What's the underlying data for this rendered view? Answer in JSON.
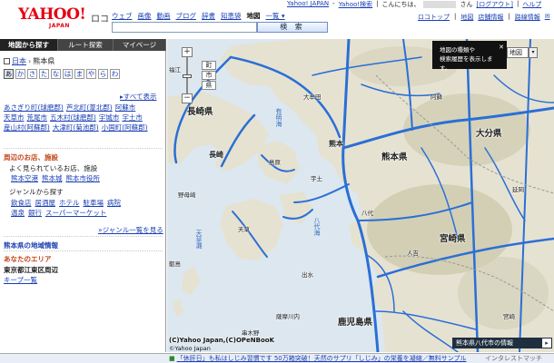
{
  "header": {
    "logo_text": "YAHOO!",
    "logo_sub": "JAPAN",
    "service_name": "ロコ",
    "service_links": [
      "ウェブ",
      "画像",
      "動画",
      "ブログ",
      "辞書",
      "知恵袋",
      "地図",
      "一覧 ▾"
    ],
    "current_service": "地図",
    "search_button": "検 索",
    "search_placeholder": "",
    "top_links": {
      "yahoo_japan": "Yahoo! JAPAN",
      "dash1": "-",
      "yahoo_search": "Yahoo!検索",
      "pipe1": "|",
      "greeting": "こんにちは、",
      "san": "さん",
      "logout": "[ログアウト]",
      "pipe2": "|",
      "help": "ヘルプ"
    },
    "tools": [
      "ロコトップ",
      "|",
      "地図",
      "店舗情報",
      "|",
      "路線情報",
      "✉",
      "⚙"
    ]
  },
  "sidebar": {
    "tabs": [
      {
        "label": "地図から探す",
        "active": true
      },
      {
        "label": "ルート探索",
        "active": false
      },
      {
        "label": "マイページ",
        "active": false
      }
    ],
    "breadcrumb": {
      "root": "日本",
      "sep": "›",
      "current": "熊本県"
    },
    "kana": [
      "あ",
      "か",
      "さ",
      "た",
      "な",
      "は",
      "ま",
      "や",
      "ら",
      "わ"
    ],
    "kana_selected": "あ",
    "show_all": "▸すべて表示",
    "cities": [
      "あさぎり町(球磨郡)",
      "芦北町(葦北郡)",
      "阿蘇市",
      "天草市",
      "荒尾市",
      "五木村(球磨郡)",
      "宇城市",
      "宇土市",
      "産山村(阿蘇郡)",
      "大津町(菊池郡)",
      "小国町(阿蘇郡)"
    ],
    "nearby_title": "周辺のお店、施設",
    "popular_title": "よく見られているお店、施設",
    "popular_links": [
      "熊本空港",
      "熊本城",
      "熊本市役所"
    ],
    "genre_title": "ジャンルから探す",
    "genre_row1": [
      "飲食店",
      "居酒屋",
      "ホテル",
      "駐車場",
      "病院"
    ],
    "genre_row2": [
      "温泉",
      "銀行",
      "スーパーマーケット"
    ],
    "genre_more": "»ジャンル一覧を見る",
    "area_info": "熊本県の地域情報",
    "your_area_title": "あなたのエリア",
    "your_area_name": "東京都江東区周辺",
    "your_area_link": "キープ一覧"
  },
  "map": {
    "zoom_in": "+",
    "zoom_out": "−",
    "zoom_tags": [
      "町",
      "市",
      "県"
    ],
    "tooltip_line1": "地図の種類や",
    "tooltip_line2": "検索履歴を表示します。",
    "tooltip_close": "✕",
    "map_type": "地図",
    "map_type_arrow": "▾",
    "labels": {
      "nagasaki_pref": "長崎県",
      "nagasaki_city": "長崎",
      "kumamoto_city": "熊本",
      "kumamoto_pref": "熊本県",
      "oita_pref": "大分県",
      "miyazaki_pref": "宮崎県",
      "kagoshima_pref": "鹿児島県",
      "shimabara": "島原",
      "omuta": "大牟田",
      "aso": "阿蘇",
      "yatsushiro": "八代",
      "hitoyoshi": "人吉",
      "amakusa": "天草",
      "nobeoka": "延岡",
      "miyazaki": "宮崎",
      "uto": "宇土",
      "izumi": "出水",
      "sendai": "薩摩川内",
      "nomozaki": "野母崎",
      "goto": "福江",
      "koshiki": "甑島",
      "nishinoomote": "串木野"
    },
    "sea_labels": {
      "ariake": "有明海",
      "yatsushiro_sea": "八代海",
      "amakusa_nada": "天草灘"
    },
    "copyright": "(C)Yahoo Japan,(C)OPeNBooK",
    "copyright2": "©Yahoo Japan",
    "city_info": "熊本県八代市の情報",
    "city_info_btn": "▸"
  },
  "footer": {
    "ad_flag": "■",
    "ad_text": "「休肝日」も私はしじみ習慣です 50万箱突破！天然のサプリ「しじみ」の栄養を凝縮／無料サンプル",
    "sponsor": "インタレストマッチ"
  },
  "colors": {
    "road": "#2a6fd6",
    "land": "#e8e4d6",
    "mountain": "#c9c7a9",
    "sea": "#dce7f0",
    "accent_red": "#e60012",
    "link": "#1a3fb3"
  }
}
